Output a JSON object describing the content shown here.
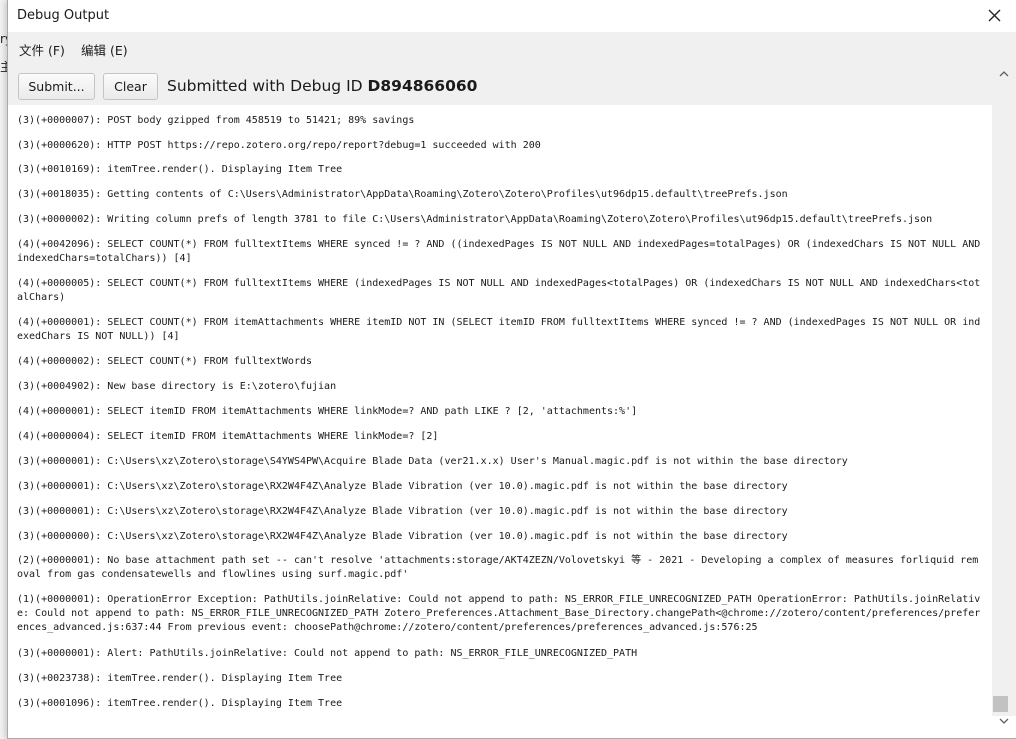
{
  "window": {
    "title": "Debug Output"
  },
  "menu": [
    {
      "label": "文件 (F)"
    },
    {
      "label": "编辑 (E)"
    }
  ],
  "toolbar": {
    "submit_label": "Submit...",
    "clear_label": "Clear",
    "status_prefix": "Submitted with Debug ID ",
    "debug_id": "D894866060"
  },
  "background": {
    "frag1": "ry",
    "frag2": "主"
  },
  "log_lines": [
    "(3)(+0000007): POST body gzipped from 458519 to 51421; 89% savings",
    "(3)(+0000620): HTTP POST https://repo.zotero.org/repo/report?debug=1 succeeded with 200",
    "(3)(+0010169): itemTree.render(). Displaying Item Tree",
    "(3)(+0018035): Getting contents of C:\\Users\\Administrator\\AppData\\Roaming\\Zotero\\Zotero\\Profiles\\ut96dp15.default\\treePrefs.json",
    "(3)(+0000002): Writing column prefs of length 3781 to file C:\\Users\\Administrator\\AppData\\Roaming\\Zotero\\Zotero\\Profiles\\ut96dp15.default\\treePrefs.json",
    "(4)(+0042096): SELECT COUNT(*) FROM fulltextItems WHERE synced != ? AND ((indexedPages IS NOT NULL AND indexedPages=totalPages) OR (indexedChars IS NOT NULL AND indexedChars=totalChars)) [4]",
    "(4)(+0000005): SELECT COUNT(*) FROM fulltextItems WHERE (indexedPages IS NOT NULL AND indexedPages<totalPages) OR (indexedChars IS NOT NULL AND indexedChars<totalChars)",
    "(4)(+0000001): SELECT COUNT(*) FROM itemAttachments WHERE itemID NOT IN (SELECT itemID FROM fulltextItems WHERE synced != ? AND (indexedPages IS NOT NULL OR indexedChars IS NOT NULL)) [4]",
    "(4)(+0000002): SELECT COUNT(*) FROM fulltextWords",
    "(3)(+0004902): New base directory is E:\\zotero\\fujian",
    "(4)(+0000001): SELECT itemID FROM itemAttachments WHERE linkMode=? AND path LIKE ? [2, 'attachments:%']",
    "(4)(+0000004): SELECT itemID FROM itemAttachments WHERE linkMode=? [2]",
    "(3)(+0000001): C:\\Users\\xz\\Zotero\\storage\\S4YWS4PW\\Acquire Blade Data (ver21.x.x) User's Manual.magic.pdf is not within the base directory",
    "(3)(+0000001): C:\\Users\\xz\\Zotero\\storage\\RX2W4F4Z\\Analyze Blade Vibration (ver 10.0).magic.pdf is not within the base directory",
    "(3)(+0000001): C:\\Users\\xz\\Zotero\\storage\\RX2W4F4Z\\Analyze Blade Vibration (ver 10.0).magic.pdf is not within the base directory",
    "(3)(+0000000): C:\\Users\\xz\\Zotero\\storage\\RX2W4F4Z\\Analyze Blade Vibration (ver 10.0).magic.pdf is not within the base directory",
    "(2)(+0000001): No base attachment path set -- can't resolve 'attachments:storage/AKT4ZEZN/Volovetskyi 等 - 2021 - Developing a complex of measures forliquid removal from gas condensatewells and flowlines using surf.magic.pdf'",
    "(1)(+0000001): OperationError Exception: PathUtils.joinRelative: Could not append to path: NS_ERROR_FILE_UNRECOGNIZED_PATH OperationError: PathUtils.joinRelative: Could not append to path: NS_ERROR_FILE_UNRECOGNIZED_PATH Zotero_Preferences.Attachment_Base_Directory.changePath<@chrome://zotero/content/preferences/preferences_advanced.js:637:44 From previous event: choosePath@chrome://zotero/content/preferences/preferences_advanced.js:576:25",
    "(3)(+0000001): Alert: PathUtils.joinRelative: Could not append to path: NS_ERROR_FILE_UNRECOGNIZED_PATH",
    "(3)(+0023738): itemTree.render(). Displaying Item Tree",
    "(3)(+0001096): itemTree.render(). Displaying Item Tree"
  ]
}
